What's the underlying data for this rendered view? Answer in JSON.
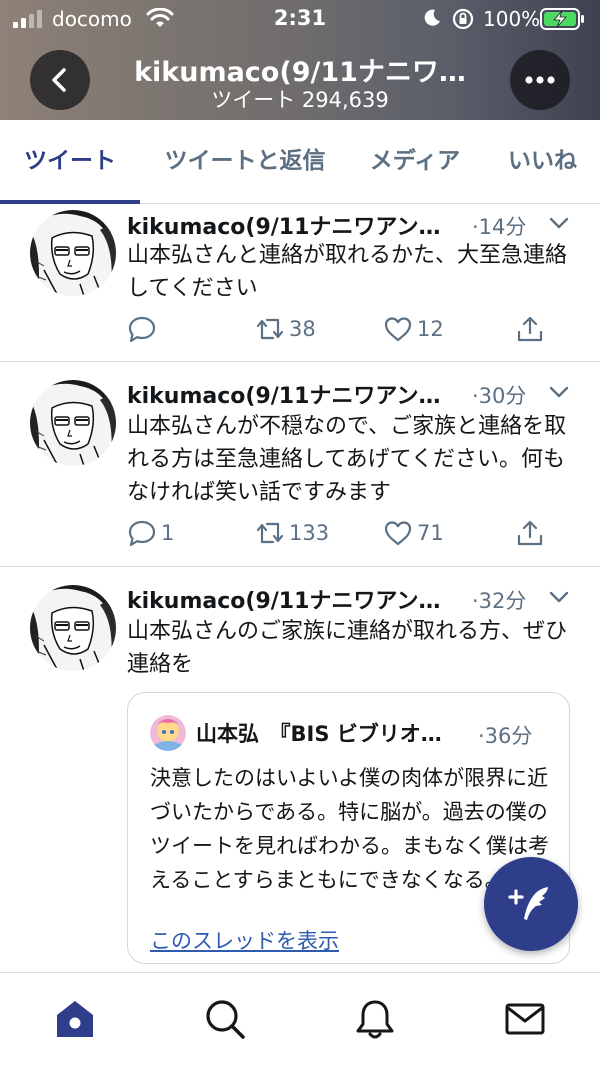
{
  "status_bar": {
    "carrier": "docomo",
    "time": "2:31",
    "battery": "100%"
  },
  "profile": {
    "name": "kikumaco(9/11ナニワ…",
    "tweet_count": "ツイート 294,639"
  },
  "tabs": [
    {
      "label": "ツイート",
      "active": true
    },
    {
      "label": "ツイートと返信",
      "active": false
    },
    {
      "label": "メディア",
      "active": false
    },
    {
      "label": "いいね",
      "active": false
    }
  ],
  "tweets": [
    {
      "author": "kikumaco(9/11ナニワアンビ…",
      "time": "·14分",
      "text": "山本弘さんと連絡が取れるかた、大至急連絡してください",
      "replies": "",
      "retweets": "38",
      "likes": "12"
    },
    {
      "author": "kikumaco(9/11ナニワアンビ…",
      "time": "·30分",
      "text": "山本弘さんが不穏なので、ご家族と連絡を取れる方は至急連絡してあげてください。何もなければ笑い話ですみます",
      "replies": "1",
      "retweets": "133",
      "likes": "71"
    },
    {
      "author": "kikumaco(9/11ナニワアンビ…",
      "time": "·32分",
      "text": "山本弘さんのご家族に連絡が取れる方、ぜひ連絡を",
      "quote": {
        "author": "山本弘　『BIS ビブリオ…",
        "time": "·36分",
        "text": "決意したのはいよいよ僕の肉体が限界に近づいたからである。特に脳が。過去の僕のツイートを見ればわかる。まもなく僕は考えることすらまともにできなくなる。",
        "thread_link": "このスレッドを表示"
      }
    }
  ],
  "colors": {
    "accent": "#2e3e8a",
    "secondary_text": "#5b7083",
    "link": "#2e5ab0"
  },
  "icons": {
    "back": "chevron-left-icon",
    "more": "more-horizontal-icon",
    "reply": "speech-bubble-icon",
    "retweet": "retweet-arrows-icon",
    "like": "heart-icon",
    "share": "share-upload-icon",
    "compose": "feather-plus-icon",
    "nav": [
      "home-icon",
      "search-icon",
      "bell-icon",
      "mail-icon"
    ]
  }
}
